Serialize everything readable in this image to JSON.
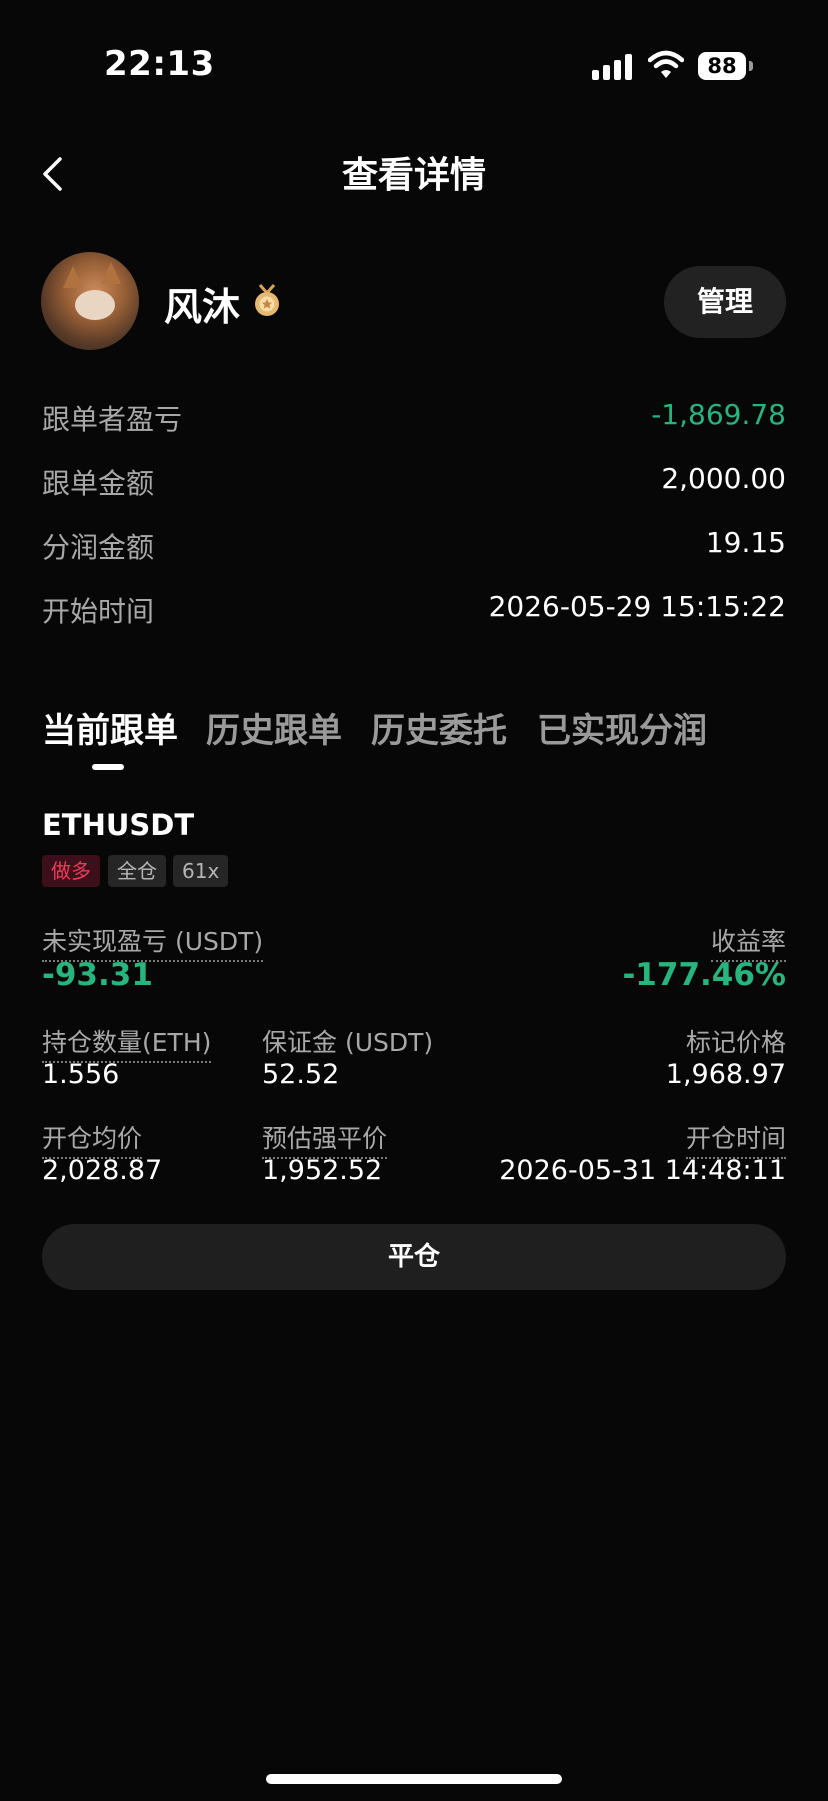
{
  "status_bar": {
    "time": "22:13",
    "battery": "88",
    "icons": [
      "signal-icon",
      "wifi-icon",
      "battery-icon"
    ]
  },
  "header": {
    "title": "查看详情",
    "back_icon": "chevron-left-icon"
  },
  "profile": {
    "name": "风沐",
    "badge_icon": "medal-icon",
    "manage_label": "管理"
  },
  "stats": {
    "pnl": {
      "label": "跟单者盈亏",
      "value": "-1,869.78",
      "color": "#27b47e"
    },
    "amount": {
      "label": "跟单金额",
      "value": "2,000.00"
    },
    "profit_share": {
      "label": "分润金额",
      "value": "19.15"
    },
    "start_time": {
      "label": "开始时间",
      "value": "2026-05-29 15:15:22"
    }
  },
  "tabs": [
    {
      "label": "当前跟单",
      "active": true
    },
    {
      "label": "历史跟单",
      "active": false
    },
    {
      "label": "历史委托",
      "active": false
    },
    {
      "label": "已实现分润",
      "active": false
    }
  ],
  "position": {
    "symbol": "ETHUSDT",
    "tags": {
      "side": "做多",
      "margin_mode": "全仓",
      "leverage": "61x"
    },
    "unrealized_pnl": {
      "label": "未实现盈亏 (USDT)",
      "value": "-93.31"
    },
    "roe": {
      "label": "收益率",
      "value": "-177.46%"
    },
    "size": {
      "label": "持仓数量(ETH)",
      "value": "1.556"
    },
    "margin": {
      "label": "保证金 (USDT)",
      "value": "52.52"
    },
    "mark_price": {
      "label": "标记价格",
      "value": "1,968.97"
    },
    "entry_price": {
      "label": "开仓均价",
      "value": "2,028.87"
    },
    "liq_price": {
      "label": "预估强平价",
      "value": "1,952.52"
    },
    "open_time": {
      "label": "开仓时间",
      "value": "2026-05-31 14:48:11"
    },
    "close_label": "平仓"
  },
  "colors": {
    "background": "#070707",
    "profit_green": "#27b47e",
    "long_red": "#ee3b5a"
  }
}
